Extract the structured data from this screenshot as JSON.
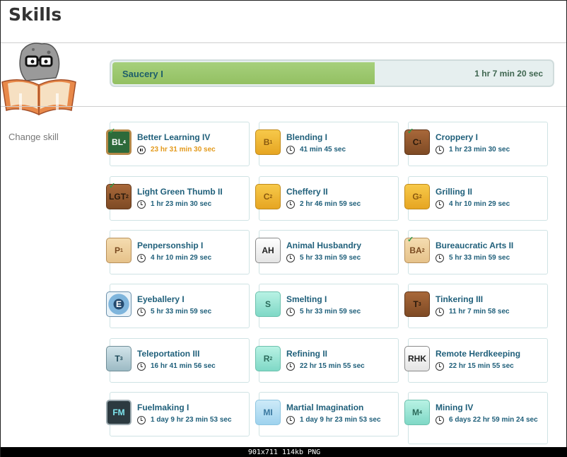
{
  "page": {
    "title": "Skills"
  },
  "sidebar": {
    "change_skill": "Change skill"
  },
  "current": {
    "name": "Saucery I",
    "remaining": "1 hr 7 min 20 sec",
    "progress": 0.6
  },
  "skills": [
    {
      "name": "Better Learning IV",
      "time": "23 hr 31 min 30 sec",
      "icon": "BL",
      "sup": "4",
      "style": "board",
      "state": "paused",
      "check": true
    },
    {
      "name": "Blending I",
      "time": "41 min 45 sec",
      "icon": "B",
      "sup": "1",
      "style": "wood-light",
      "state": "idle",
      "check": false
    },
    {
      "name": "Croppery I",
      "time": "1 hr 23 min 30 sec",
      "icon": "C",
      "sup": "1",
      "style": "wood-dark",
      "state": "idle",
      "check": true
    },
    {
      "name": "Light Green Thumb II",
      "time": "1 hr 23 min 30 sec",
      "icon": "LGT",
      "sup": "2",
      "style": "wood-dark",
      "state": "idle",
      "check": true
    },
    {
      "name": "Cheffery II",
      "time": "2 hr 46 min 59 sec",
      "icon": "C",
      "sup": "2",
      "style": "wood-light",
      "state": "idle",
      "check": false
    },
    {
      "name": "Grilling II",
      "time": "4 hr 10 min 29 sec",
      "icon": "G",
      "sup": "2",
      "style": "wood-light",
      "state": "idle",
      "check": false
    },
    {
      "name": "Penpersonship I",
      "time": "4 hr 10 min 29 sec",
      "icon": "P",
      "sup": "1",
      "style": "scroll",
      "state": "idle",
      "check": false
    },
    {
      "name": "Animal Husbandry",
      "time": "5 hr 33 min 59 sec",
      "icon": "AH",
      "sup": "",
      "style": "stone",
      "state": "idle",
      "check": false
    },
    {
      "name": "Bureaucratic Arts II",
      "time": "5 hr 33 min 59 sec",
      "icon": "BA",
      "sup": "2",
      "style": "scroll",
      "state": "idle",
      "check": true
    },
    {
      "name": "Eyeballery I",
      "time": "5 hr 33 min 59 sec",
      "icon": "E",
      "sup": "",
      "style": "eye",
      "state": "idle",
      "check": false
    },
    {
      "name": "Smelting I",
      "time": "5 hr 33 min 59 sec",
      "icon": "S",
      "sup": "",
      "style": "ice",
      "state": "idle",
      "check": false
    },
    {
      "name": "Tinkering III",
      "time": "11 hr 7 min 58 sec",
      "icon": "T",
      "sup": "3",
      "style": "wood-dark",
      "state": "idle",
      "check": false
    },
    {
      "name": "Teleportation III",
      "time": "16 hr 41 min 56 sec",
      "icon": "T",
      "sup": "3",
      "style": "metal",
      "state": "idle",
      "check": false
    },
    {
      "name": "Refining II",
      "time": "22 hr 15 min 55 sec",
      "icon": "R",
      "sup": "2",
      "style": "ice",
      "state": "idle",
      "check": false
    },
    {
      "name": "Remote Herdkeeping",
      "time": "22 hr 15 min 55 sec",
      "icon": "RHK",
      "sup": "",
      "style": "stone",
      "state": "idle",
      "check": false
    },
    {
      "name": "Fuelmaking I",
      "time": "1 day 9 hr 23 min 53 sec",
      "icon": "FM",
      "sup": "",
      "style": "fm",
      "state": "idle",
      "check": false
    },
    {
      "name": "Martial Imagination",
      "time": "1 day 9 hr 23 min 53 sec",
      "icon": "MI",
      "sup": "",
      "style": "cloud",
      "state": "idle",
      "check": false
    },
    {
      "name": "Mining IV",
      "time": "6 days 22 hr 59 min 24 sec",
      "icon": "M",
      "sup": "4",
      "style": "ice",
      "state": "idle",
      "check": false
    }
  ],
  "statusbar": {
    "text": "901x711  114kb  PNG"
  }
}
